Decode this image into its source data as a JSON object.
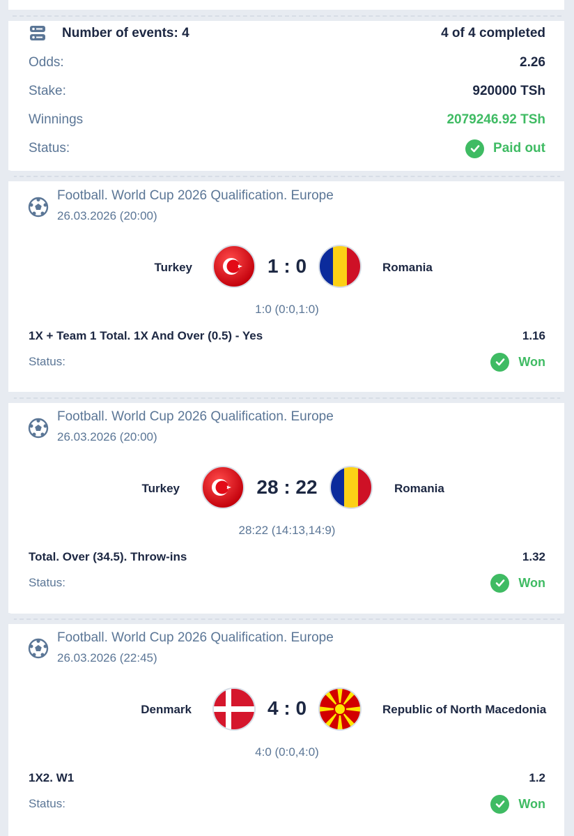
{
  "summary": {
    "events_label": "Number of events: 4",
    "completed": "4 of 4 completed",
    "odds_label": "Odds:",
    "odds_value": "2.26",
    "stake_label": "Stake:",
    "stake_value": "920000 TSh",
    "winnings_label": "Winnings",
    "winnings_value": "2079246.92 TSh",
    "status_label": "Status:",
    "status_value": "Paid out"
  },
  "events": [
    {
      "league": "Football. World Cup 2026 Qualification. Europe",
      "date": "26.03.2026 (20:00)",
      "team1": "Turkey",
      "team2": "Romania",
      "score": "1 : 0",
      "detail": "1:0 (0:0,1:0)",
      "bet": "1X + Team 1 Total. 1X And Over (0.5) - Yes",
      "odds": "1.16",
      "status_label": "Status:",
      "status": "Won"
    },
    {
      "league": "Football. World Cup 2026 Qualification. Europe",
      "date": "26.03.2026 (20:00)",
      "team1": "Turkey",
      "team2": "Romania",
      "score": "28 : 22",
      "detail": "28:22 (14:13,14:9)",
      "bet": "Total. Over (34.5). Throw-ins",
      "odds": "1.32",
      "status_label": "Status:",
      "status": "Won"
    },
    {
      "league": "Football. World Cup 2026 Qualification. Europe",
      "date": "26.03.2026 (22:45)",
      "team1": "Denmark",
      "team2": "Republic of North Macedonia",
      "score": "4 : 0",
      "detail": "4:0 (0:0,4:0)",
      "bet": "1X2. W1",
      "odds": "1.2",
      "status_label": "Status:",
      "status": "Won"
    }
  ],
  "colors": {
    "accent_green": "#3fbb63",
    "text_dark": "#1c2742",
    "text_muted": "#5b7696",
    "background": "#e7ebf1"
  }
}
